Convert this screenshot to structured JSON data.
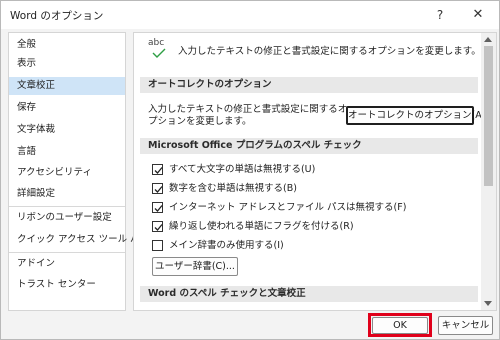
{
  "window": {
    "title": "Word のオプション",
    "help_glyph": "?",
    "close_glyph": "✕"
  },
  "sidebar": {
    "items": [
      {
        "label": "全般"
      },
      {
        "label": "表示"
      },
      {
        "label": "文章校正",
        "selected": true
      },
      {
        "label": "保存"
      },
      {
        "label": "文字体裁"
      },
      {
        "label": "言語"
      },
      {
        "label": "アクセシビリティ"
      },
      {
        "label": "詳細設定"
      },
      {
        "label": "リボンのユーザー設定"
      },
      {
        "label": "クイック アクセス ツール バー"
      },
      {
        "label": "アドイン"
      },
      {
        "label": "トラスト センター"
      }
    ]
  },
  "main": {
    "header_icon_text": "abc",
    "header_desc": "入力したテキストの修正と書式設定に関するオプションを変更します。",
    "autocorrect": {
      "section_title": "オートコレクトのオプション",
      "desc": "入力したテキストの修正と書式設定に関するオプションを変更します。",
      "button_label": "オートコレクトのオプション(A)..."
    },
    "office_spelling": {
      "section_title": "Microsoft Office プログラムのスペル チェック",
      "checkboxes": [
        {
          "label": "すべて大文字の単語は無視する(U)",
          "checked": true
        },
        {
          "label": "数字を含む単語は無視する(B)",
          "checked": true
        },
        {
          "label": "インターネット アドレスとファイル パスは無視する(F)",
          "checked": true
        },
        {
          "label": "繰り返し使われる単語にフラグを付ける(R)",
          "checked": true
        },
        {
          "label": "メイン辞書のみ使用する(I)",
          "checked": false
        }
      ],
      "dictionary_button": "ユーザー辞書(C)..."
    },
    "word_spelling": {
      "section_title": "Word のスペル チェックと文章校正"
    }
  },
  "footer": {
    "ok_label": "OK",
    "cancel_label": "キャンセル"
  },
  "colors": {
    "selected_nav": "#cfe4f7",
    "highlight": "#e0001a",
    "check_green": "#2e9e44"
  }
}
